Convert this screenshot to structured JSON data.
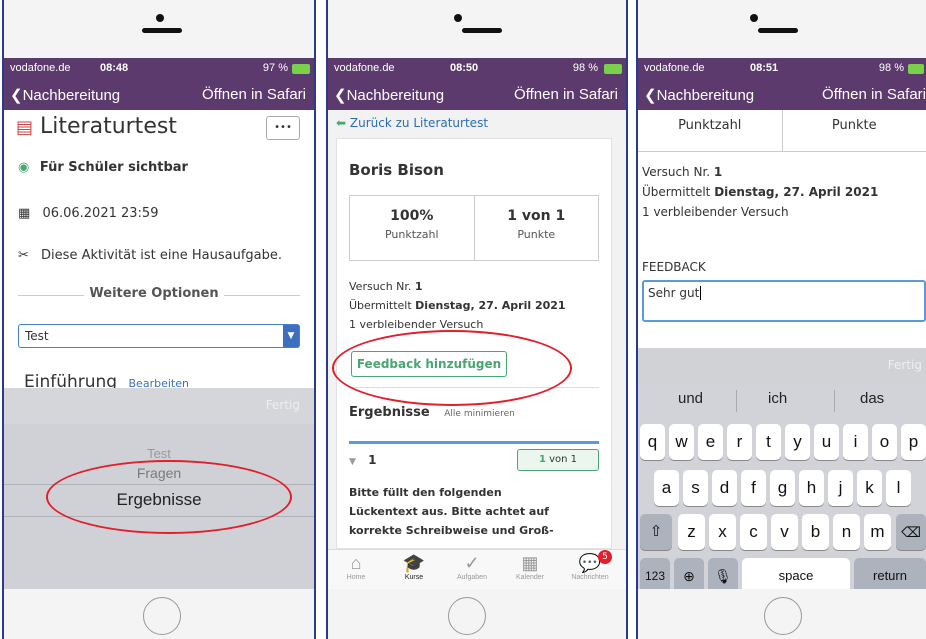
{
  "phone1": {
    "status": {
      "carrier": "vodafone.de",
      "time": "08:48",
      "battery": "97 %"
    },
    "nav": {
      "back": "Nachbereitung",
      "safari": "Öffnen in Safari"
    },
    "title": "Literaturtest",
    "more": "•••",
    "visible": "Für Schüler sichtbar",
    "date": "06.06.2021 23:59",
    "homework": "Diese Aktivität ist eine Hausaufgabe.",
    "more_options": "Weitere Optionen",
    "select_value": "Test",
    "intro": "Einführung",
    "edit": "Bearbeiten",
    "done": "Fertig",
    "picker": [
      "Test",
      "Fragen",
      "Ergebnisse"
    ]
  },
  "phone2": {
    "status": {
      "carrier": "vodafone.de",
      "time": "08:50",
      "battery": "98 %"
    },
    "nav": {
      "back": "Nachbereitung",
      "safari": "Öffnen in Safari"
    },
    "back_link": "Zurück zu Literaturtest",
    "student": "Boris Bison",
    "score_pct": "100%",
    "score_pct_label": "Punktzahl",
    "score_pts": "1 von 1",
    "score_pts_label": "Punkte",
    "attempt_label": "Versuch Nr.",
    "attempt_no": "1",
    "submitted_label": "Übermittelt",
    "submitted_date": "Dienstag, 27. April 2021",
    "remaining": "1 verbleibender Versuch",
    "feedback_button": "Feedback hinzufügen",
    "results": "Ergebnisse",
    "collapse_all": "Alle minimieren",
    "q_no": "1",
    "q_score_bold": "1",
    "q_score_rest": "von 1",
    "q_text": "Bitte füllt den folgenden Lückentext aus. Bitte achtet auf korrekte Schreibweise und Groß- und Kleinschreibung.",
    "tabs": [
      "Home",
      "Kurse",
      "Aufgaben",
      "Kalender",
      "Nachrichten"
    ],
    "badge": "5"
  },
  "phone3": {
    "status": {
      "carrier": "vodafone.de",
      "time": "08:51",
      "battery": "98 %"
    },
    "nav": {
      "back": "Nachbereitung",
      "safari": "Öffnen in Safari"
    },
    "col1": "Punktzahl",
    "col2": "Punkte",
    "attempt_label": "Versuch Nr.",
    "attempt_no": "1",
    "submitted_label": "Übermittelt",
    "submitted_date": "Dienstag, 27. April 2021",
    "remaining": "1 verbleibender Versuch",
    "feedback_label": "FEEDBACK",
    "feedback_value": "Sehr gut",
    "done": "Fertig",
    "suggestions": [
      "und",
      "ich",
      "das"
    ],
    "row1": [
      "q",
      "w",
      "e",
      "r",
      "t",
      "y",
      "u",
      "i",
      "o",
      "p"
    ],
    "row2": [
      "a",
      "s",
      "d",
      "f",
      "g",
      "h",
      "j",
      "k",
      "l"
    ],
    "row3": [
      "z",
      "x",
      "c",
      "v",
      "b",
      "n",
      "m"
    ],
    "key123": "123",
    "space": "space",
    "return": "return"
  }
}
